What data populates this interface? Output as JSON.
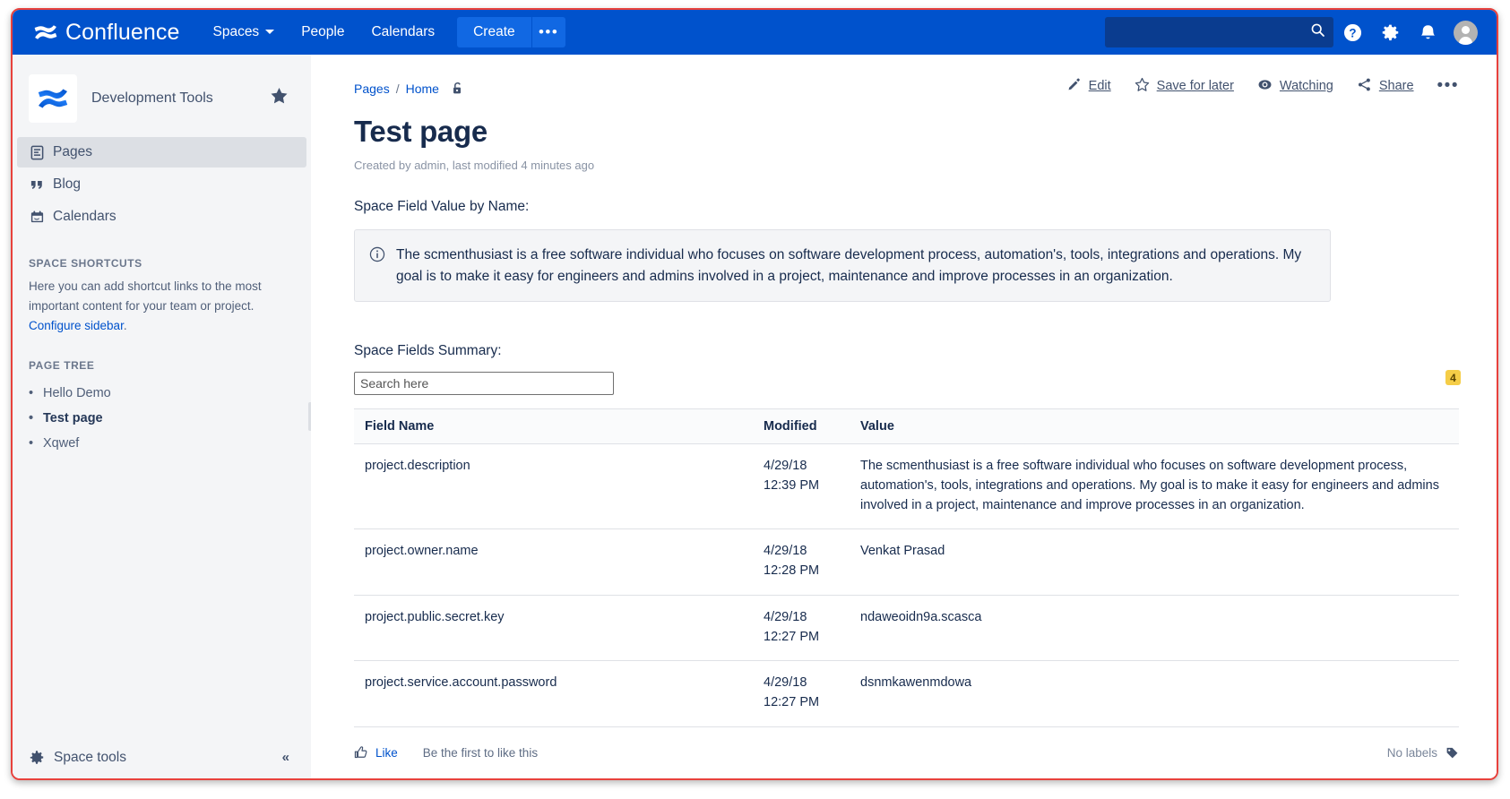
{
  "topnav": {
    "brand": "Confluence",
    "brand_icon": "confluence-logo-icon",
    "links": [
      {
        "label": "Spaces",
        "has_chevron": true,
        "chevron": "⌄"
      },
      {
        "label": "People",
        "has_chevron": false
      },
      {
        "label": "Calendars",
        "has_chevron": false
      }
    ],
    "create_label": "Create",
    "create_more_label": "•••",
    "search_placeholder": "",
    "search_value": "",
    "icons": [
      "search-icon",
      "help-icon",
      "settings-gear-icon",
      "notifications-bell-icon",
      "user-avatar-icon"
    ],
    "bg_color": "#0052cc",
    "create_color": "#1168e3"
  },
  "sidebar": {
    "space_name": "Development Tools",
    "space_logo_icon": "confluence-space-logo-icon",
    "star_icon": "star-filled-icon",
    "nav": [
      {
        "label": "Pages",
        "icon": "pages-icon",
        "active": true
      },
      {
        "label": "Blog",
        "icon": "blog-quote-icon",
        "active": false
      },
      {
        "label": "Calendars",
        "icon": "calendar-icon",
        "active": false
      }
    ],
    "shortcuts_title": "SPACE SHORTCUTS",
    "shortcuts_text": "Here you can add shortcut links to the most important content for your team or project. ",
    "shortcuts_link": "Configure sidebar",
    "shortcuts_link_suffix": ".",
    "pagetree_title": "PAGE TREE",
    "pagetree": [
      {
        "label": "Hello Demo",
        "current": false
      },
      {
        "label": "Test page",
        "current": true
      },
      {
        "label": "Xqwef",
        "current": false
      }
    ],
    "space_tools_label": "Space tools",
    "space_tools_icon": "gear-icon",
    "collapse_label": "«"
  },
  "content": {
    "breadcrumb": [
      {
        "label": "Pages"
      },
      {
        "label": "Home"
      }
    ],
    "breadcrumb_separator": "/",
    "restrictions_icon": "unlocked-padlock-icon",
    "page_actions": [
      {
        "label": "Edit",
        "icon": "pencil-icon"
      },
      {
        "label": "Save for later",
        "icon": "star-outline-icon"
      },
      {
        "label": "Watching",
        "icon": "eye-icon"
      },
      {
        "label": "Share",
        "icon": "share-icon"
      }
    ],
    "page_actions_more": "•••",
    "title": "Test page",
    "meta": "Created by admin, last modified 4 minutes ago",
    "field_value_label": "Space Field Value by Name:",
    "info_icon": "info-circle-icon",
    "info_text": "The scmenthusiast is a free software individual who focuses on software development process, automation's, tools, integrations and operations. My goal is to make it easy for engineers and admins involved in a project, maintenance and improve processes in an organization.",
    "summary_label": "Space Fields Summary:",
    "search_placeholder": "Search here",
    "search_value": "",
    "result_count_badge": "4",
    "badge_color": "#f5cd47",
    "table": {
      "columns": [
        "Field Name",
        "Modified",
        "Value"
      ],
      "rows": [
        {
          "name": "project.description",
          "date": "4/29/18",
          "time": "12:39 PM",
          "value": "The scmenthusiast is a free software individual who focuses on software development process, automation's, tools, integrations and operations. My goal is to make it easy for engineers and admins involved in a project, maintenance and improve processes in an organization."
        },
        {
          "name": "project.owner.name",
          "date": "4/29/18",
          "time": "12:28 PM",
          "value": "Venkat Prasad"
        },
        {
          "name": "project.public.secret.key",
          "date": "4/29/18",
          "time": "12:27 PM",
          "value": "ndaweoidn9a.scasca"
        },
        {
          "name": "project.service.account.password",
          "date": "4/29/18",
          "time": "12:27 PM",
          "value": "dsnmkawenmdowa"
        }
      ]
    },
    "footer": {
      "like_label": "Like",
      "like_icon": "thumbs-up-icon",
      "like_status": "Be the first to like this",
      "labels_text": "No labels",
      "labels_icon": "tag-icon"
    }
  }
}
